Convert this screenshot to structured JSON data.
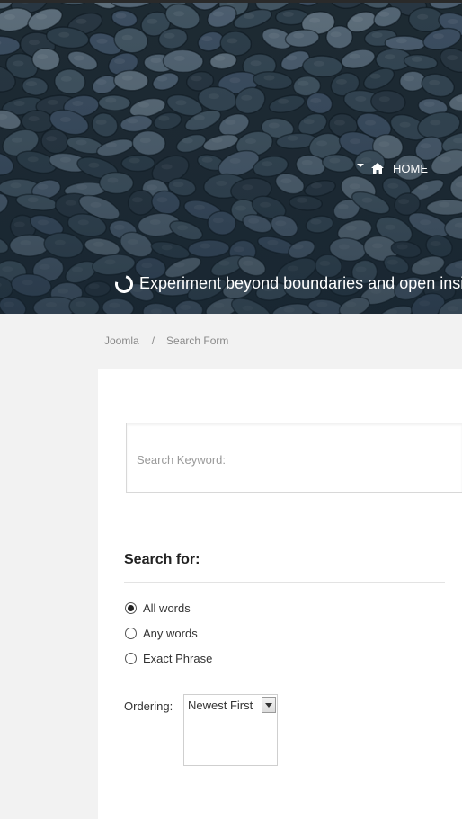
{
  "nav": {
    "home_label": "HOME"
  },
  "hero": {
    "tagline": "Experiment beyond boundaries and open insights"
  },
  "breadcrumb": {
    "items": [
      "Joomla",
      "Search Form"
    ],
    "separator": "/"
  },
  "search": {
    "placeholder": "Search Keyword:",
    "value": ""
  },
  "search_for": {
    "heading": "Search for:",
    "options": [
      {
        "label": "All words",
        "checked": true
      },
      {
        "label": "Any words",
        "checked": false
      },
      {
        "label": "Exact Phrase",
        "checked": false
      }
    ]
  },
  "ordering": {
    "label": "Ordering:",
    "selected": "Newest First"
  },
  "colors": {
    "hero_tint": "#2b3a45",
    "page_bg": "#f2f2f2",
    "panel_bg": "#ffffff",
    "text": "#333333"
  },
  "icons": {
    "home": "home-icon",
    "tagline": "spinner-icon",
    "dropdown": "chevron-down-icon"
  }
}
